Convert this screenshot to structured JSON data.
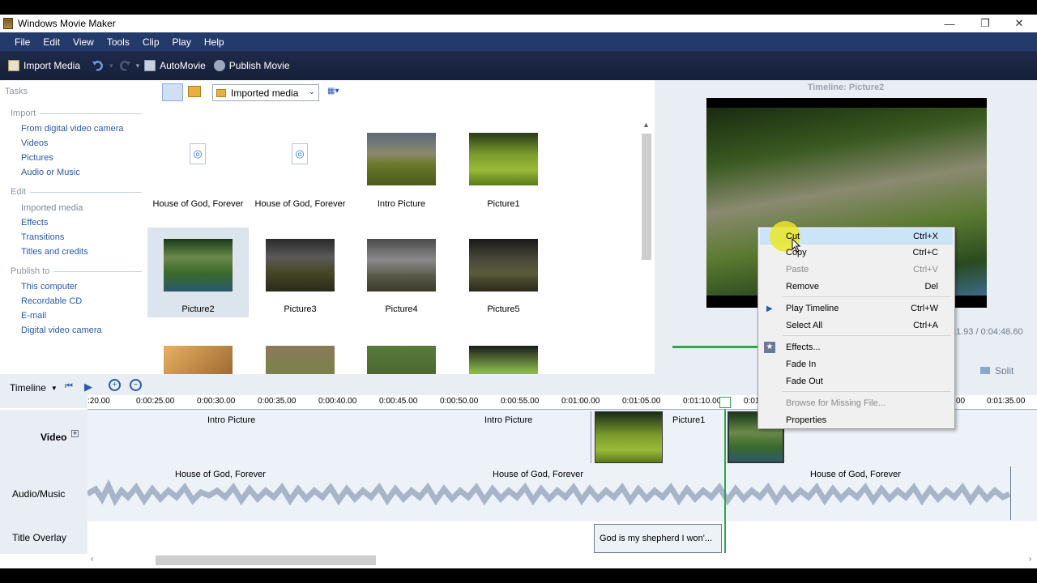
{
  "window": {
    "title": "Windows Movie Maker",
    "minimize": "—",
    "restore": "❐",
    "close": "✕"
  },
  "menu": [
    "File",
    "Edit",
    "View",
    "Tools",
    "Clip",
    "Play",
    "Help"
  ],
  "toolbar": {
    "import_media": "Import Media",
    "automovie": "AutoMovie",
    "publish_movie": "Publish Movie"
  },
  "tasks": {
    "header": "Tasks",
    "import": {
      "title": "Import",
      "items": [
        "From digital video camera",
        "Videos",
        "Pictures",
        "Audio or Music"
      ]
    },
    "edit": {
      "title": "Edit",
      "items": [
        "Imported media",
        "Effects",
        "Transitions",
        "Titles and credits"
      ]
    },
    "publish": {
      "title": "Publish to",
      "items": [
        "This computer",
        "Recordable CD",
        "E-mail",
        "Digital video camera"
      ]
    }
  },
  "collection": {
    "selected": "Imported media"
  },
  "media_items": [
    {
      "label": "House of God, Forever",
      "kind": "audio"
    },
    {
      "label": "House of God, Forever",
      "kind": "audio"
    },
    {
      "label": "Intro Picture",
      "kind": "image"
    },
    {
      "label": "Picture1",
      "kind": "image"
    },
    {
      "label": "Picture2",
      "kind": "image",
      "selected": true
    },
    {
      "label": "Picture3",
      "kind": "image"
    },
    {
      "label": "Picture4",
      "kind": "image"
    },
    {
      "label": "Picture5",
      "kind": "image"
    },
    {
      "label": "",
      "kind": "image"
    },
    {
      "label": "",
      "kind": "image"
    },
    {
      "label": "",
      "kind": "image"
    },
    {
      "label": "",
      "kind": "image"
    }
  ],
  "preview": {
    "title": "Timeline: Picture2",
    "time": "1.93 / 0:04:48.60",
    "split": "Split"
  },
  "timeline": {
    "label": "Timeline",
    "ticks": [
      ":20.00",
      "0:00:25.00",
      "0:00:30.00",
      "0:00:35.00",
      "0:00:40.00",
      "0:00:45.00",
      "0:00:50.00",
      "0:00:55.00",
      "0:01:00.00",
      "0:01:05.00",
      "0:01:10.00",
      "0:01",
      "00",
      "0:01:35.00"
    ],
    "tracks": {
      "video": "Video",
      "audio": "Audio/Music",
      "title": "Title Overlay"
    },
    "video_clips": [
      "Intro Picture",
      "Intro Picture",
      "Picture1"
    ],
    "audio_clips": [
      "House of God, Forever",
      "House of God, Forever",
      "House of God, Forever"
    ],
    "title_clip": "God is my shepherd I won'..."
  },
  "context_menu": [
    {
      "label": "Cut",
      "shortcut": "Ctrl+X",
      "state": "highlighted"
    },
    {
      "label": "Copy",
      "shortcut": "Ctrl+C",
      "state": "normal"
    },
    {
      "label": "Paste",
      "shortcut": "Ctrl+V",
      "state": "disabled"
    },
    {
      "label": "Remove",
      "shortcut": "Del",
      "state": "normal"
    },
    {
      "label": "Play Timeline",
      "shortcut": "Ctrl+W",
      "state": "normal",
      "icon": "play-icon"
    },
    {
      "label": "Select All",
      "shortcut": "Ctrl+A",
      "state": "normal"
    },
    {
      "label": "Effects...",
      "shortcut": "",
      "state": "normal",
      "icon": "effects-icon"
    },
    {
      "label": "Fade In",
      "shortcut": "",
      "state": "normal"
    },
    {
      "label": "Fade Out",
      "shortcut": "",
      "state": "normal"
    },
    {
      "label": "Browse for Missing File...",
      "shortcut": "",
      "state": "disabled"
    },
    {
      "label": "Properties",
      "shortcut": "",
      "state": "normal"
    }
  ],
  "colors": {
    "menubar": "#243a6a",
    "toolbar": "#1e2a4a",
    "link": "#2a5aa8",
    "playhead": "#2aa84a"
  }
}
